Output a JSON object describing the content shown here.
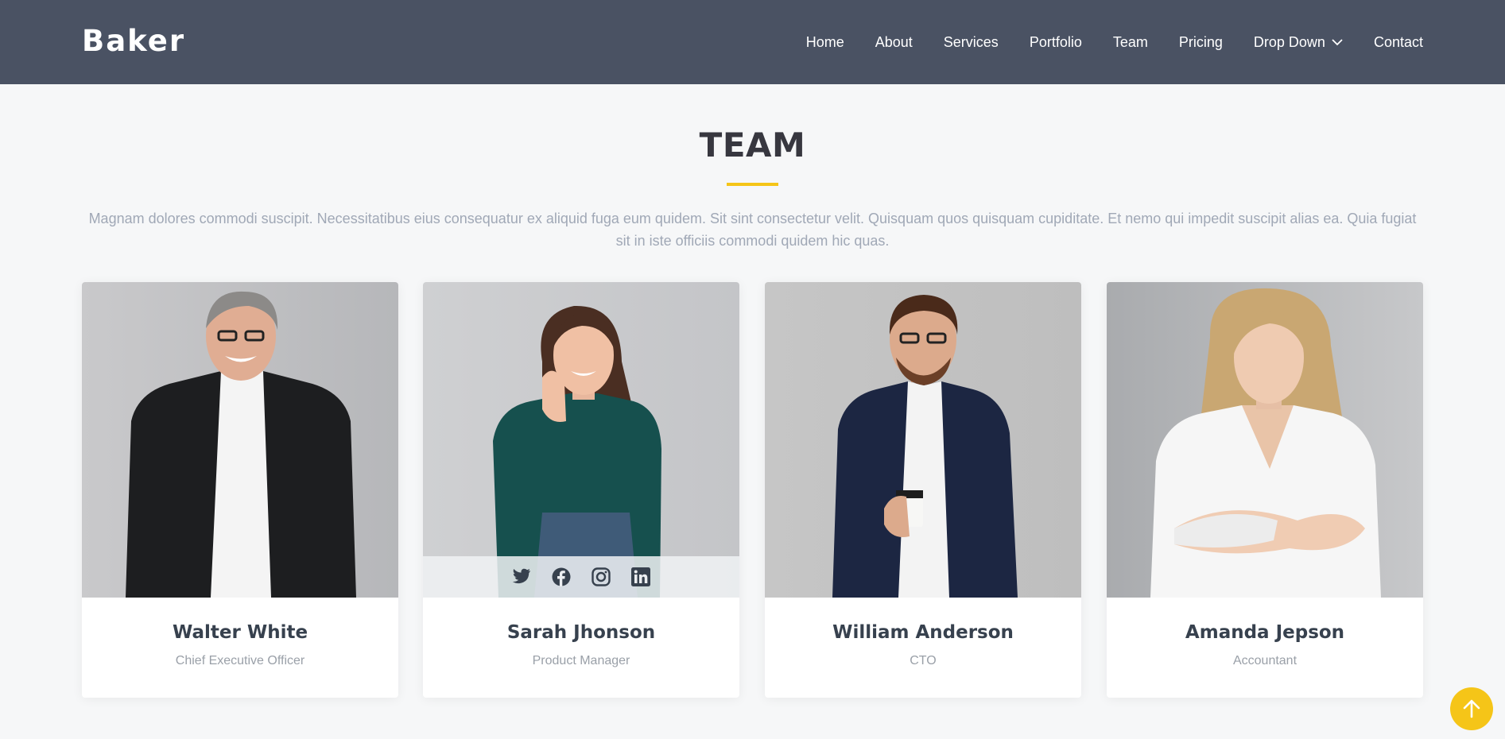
{
  "brand": {
    "logo": "Baker"
  },
  "nav": {
    "items": [
      "Home",
      "About",
      "Services",
      "Portfolio",
      "Team",
      "Pricing",
      "Drop Down",
      "Contact"
    ]
  },
  "team": {
    "title": "TEAM",
    "intro": "Magnam dolores commodi suscipit. Necessitatibus eius consequatur ex aliquid fuga eum quidem. Sit sint consectetur velit. Quisquam quos quisquam cupiditate. Et nemo qui impedit suscipit alias ea. Quia fugiat sit in iste officiis commodi quidem hic quas.",
    "members": [
      {
        "name": "Walter White",
        "role": "Chief Executive Officer"
      },
      {
        "name": "Sarah Jhonson",
        "role": "Product Manager",
        "social_icons": [
          "twitter-icon",
          "facebook-icon",
          "instagram-icon",
          "linkedin-icon"
        ]
      },
      {
        "name": "William Anderson",
        "role": "CTO"
      },
      {
        "name": "Amanda Jepson",
        "role": "Accountant"
      }
    ]
  },
  "colors": {
    "header_bg": "#4a5263",
    "accent": "#f5c518",
    "page_bg": "#f6f7f8"
  },
  "icons": {
    "scroll_top": "arrow-up-icon",
    "dropdown": "chevron-down-icon"
  }
}
